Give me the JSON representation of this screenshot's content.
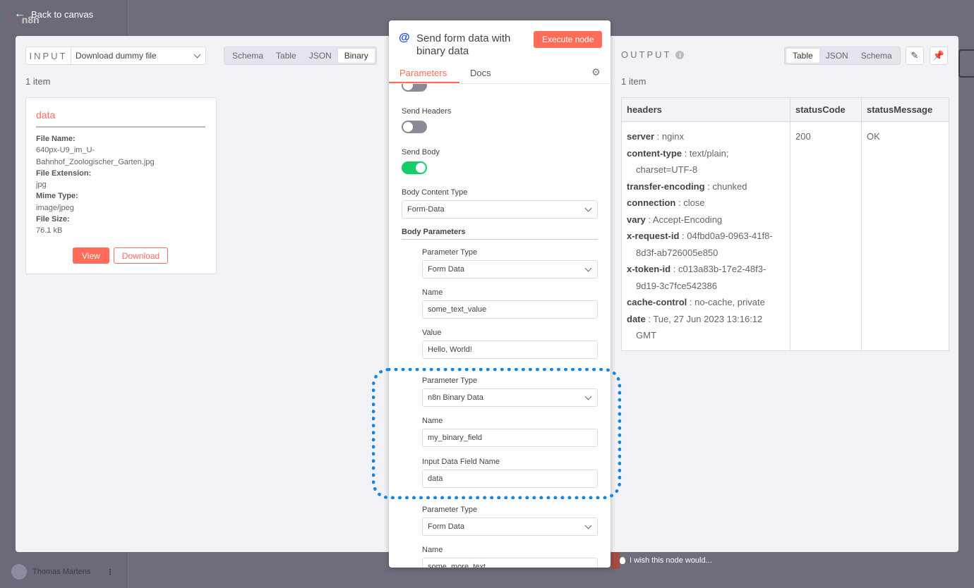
{
  "app": {
    "logo_text": "n8n",
    "back_label": "Back to canvas",
    "user_name": "Thomas Martens",
    "wish_text": "I wish this node would..."
  },
  "input": {
    "label": "INPUT",
    "source_node": "Download dummy file",
    "tabs": [
      "Schema",
      "Table",
      "JSON",
      "Binary"
    ],
    "active_tab": "Binary",
    "item_count": "1 item",
    "card": {
      "title": "data",
      "file_name_label": "File Name:",
      "file_name_line1": "640px-U9_im_U-",
      "file_name_line2": "Bahnhof_Zoologischer_Garten.jpg",
      "ext_label": "File Extension:",
      "ext_value": "jpg",
      "mime_label": "Mime Type:",
      "mime_value": "image/jpeg",
      "size_label": "File Size:",
      "size_value": "76.1 kB",
      "view_label": "View",
      "download_label": "Download"
    }
  },
  "node": {
    "icon": "@",
    "title": "Send form data with binary data",
    "execute_label": "Execute node",
    "tabs": {
      "parameters": "Parameters",
      "docs": "Docs"
    },
    "send_headers_label": "Send Headers",
    "send_headers_on": false,
    "send_body_label": "Send Body",
    "send_body_on": true,
    "body_content_type_label": "Body Content Type",
    "body_content_type_value": "Form-Data",
    "body_parameters_label": "Body Parameters",
    "params": [
      {
        "type_label": "Parameter Type",
        "type_value": "Form Data",
        "name_label": "Name",
        "name_value": "some_text_value",
        "value_label": "Value",
        "value_value": "Hello, World!"
      },
      {
        "type_label": "Parameter Type",
        "type_value": "n8n Binary Data",
        "name_label": "Name",
        "name_value": "my_binary_field",
        "field_label": "Input Data Field Name",
        "field_value": "data"
      },
      {
        "type_label": "Parameter Type",
        "type_value": "Form Data",
        "name_label": "Name",
        "name_value": "some_more_text"
      }
    ]
  },
  "output": {
    "label": "OUTPUT",
    "tabs": [
      "Table",
      "JSON",
      "Schema"
    ],
    "active_tab": "Table",
    "item_count": "1 item",
    "columns": [
      "headers",
      "statusCode",
      "statusMessage"
    ],
    "headers": [
      {
        "k": "server",
        "v": "nginx"
      },
      {
        "k": "content-type",
        "v": "text/plain; charset=UTF-8"
      },
      {
        "k": "transfer-encoding",
        "v": "chunked"
      },
      {
        "k": "connection",
        "v": "close"
      },
      {
        "k": "vary",
        "v": "Accept-Encoding"
      },
      {
        "k": "x-request-id",
        "v": "04fbd0a9-0963-41f8-8d3f-ab726005e850"
      },
      {
        "k": "x-token-id",
        "v": "c013a83b-17e2-48f3-9d19-3c7fce542386"
      },
      {
        "k": "cache-control",
        "v": "no-cache, private"
      },
      {
        "k": "date",
        "v": "Tue, 27 Jun 2023 13:16:12 GMT"
      }
    ],
    "status_code": "200",
    "status_message": "OK"
  },
  "colors": {
    "accent": "#ff6d5a",
    "toggle_on": "#13ce66",
    "highlight": "#1387e6",
    "node_icon": "#1d3fd3"
  },
  "icons": {
    "back": "arrow-left-icon",
    "info": "info-icon",
    "edit": "pencil-icon",
    "pin": "pin-icon",
    "settings": "gear-icon",
    "dropdown": "chevron-down-icon",
    "wish": "lightbulb-icon"
  }
}
